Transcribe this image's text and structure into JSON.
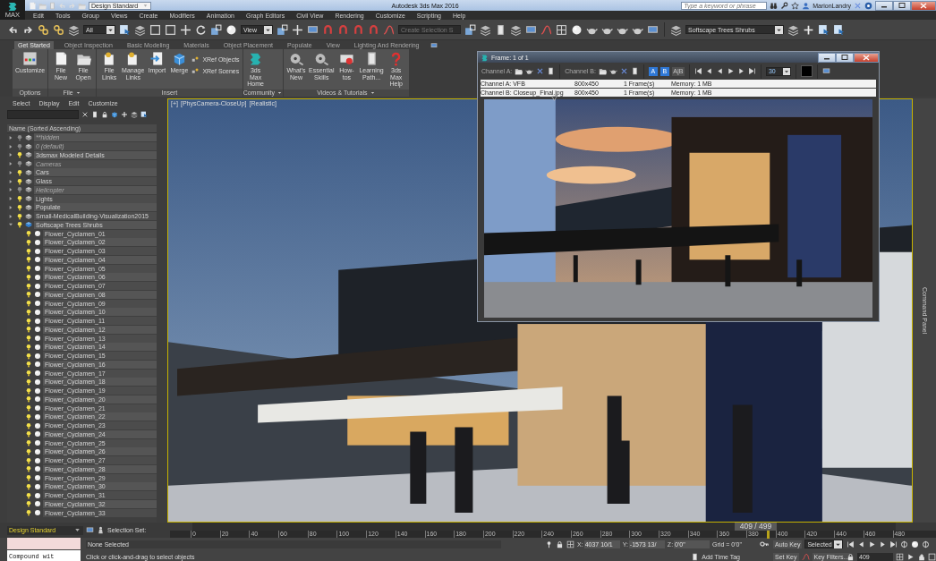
{
  "title_bar": {
    "app_badge": "MAX",
    "workspace": "Design Standard",
    "title": "Autodesk 3ds Max 2016",
    "search": {
      "placeholder": "Type a keyword or phrase"
    },
    "user": "MarionLandry"
  },
  "menu": [
    "Edit",
    "Tools",
    "Group",
    "Views",
    "Create",
    "Modifiers",
    "Animation",
    "Graph Editors",
    "Civil View",
    "Rendering",
    "Customize",
    "Scripting",
    "Help"
  ],
  "toolbar": {
    "selection_filter": "All",
    "reference_coord": "View",
    "selection_set": {
      "placeholder": "Create Selection S"
    },
    "layer": "Softscape Trees Shrubs"
  },
  "ribbon": {
    "tabs": [
      {
        "label": "Get Started",
        "selected": true
      },
      {
        "label": "Object Inspection",
        "selected": false
      },
      {
        "label": "Basic Modeling",
        "selected": false
      },
      {
        "label": "Materials",
        "selected": false
      },
      {
        "label": "Object Placement",
        "selected": false
      },
      {
        "label": "Populate",
        "selected": false
      },
      {
        "label": "View",
        "selected": false
      },
      {
        "label": "Lighting And Rendering",
        "selected": false
      }
    ],
    "groups": [
      {
        "label": "Options",
        "menu": false,
        "buttons": [
          {
            "label": "Customize",
            "kind": "large"
          }
        ]
      },
      {
        "label": "File",
        "menu": true,
        "buttons": [
          {
            "label": "File New",
            "kind": "large"
          },
          {
            "label": "File Open",
            "kind": "large"
          }
        ]
      },
      {
        "label": "Insert",
        "menu": false,
        "buttons": [
          {
            "label": "File Links",
            "kind": "large"
          },
          {
            "label": "Manage Links",
            "kind": "large"
          },
          {
            "label": "Import",
            "kind": "large"
          },
          {
            "label": "Merge",
            "kind": "large"
          },
          {
            "label": "XRef Objects",
            "kind": "small"
          },
          {
            "label": "XRef Scenes",
            "kind": "small"
          }
        ]
      },
      {
        "label": "Community",
        "menu": true,
        "buttons": [
          {
            "label": "3ds Max Home",
            "kind": "large"
          }
        ]
      },
      {
        "label": "Videos & Tutorials",
        "menu": true,
        "buttons": [
          {
            "label": "What's New",
            "kind": "large"
          },
          {
            "label": "Essential Skills",
            "kind": "large"
          },
          {
            "label": "How-tos",
            "kind": "large"
          },
          {
            "label": "Learning Path...",
            "kind": "large"
          },
          {
            "label": "3ds Max Help",
            "kind": "large"
          }
        ]
      }
    ]
  },
  "scene_explorer": {
    "menu": [
      "Select",
      "Display",
      "Edit",
      "Customize"
    ],
    "column": "Name (Sorted Ascending)",
    "tree": [
      {
        "name": "**hidden",
        "hidden": true,
        "active": false,
        "expanded": false
      },
      {
        "name": "0 (default)",
        "hidden": true,
        "active": false,
        "expanded": false
      },
      {
        "name": "3dsmax Modeled Details",
        "hidden": false,
        "active": false,
        "expanded": false
      },
      {
        "name": "Cameras",
        "hidden": true,
        "active": false,
        "expanded": false
      },
      {
        "name": "Cars",
        "hidden": false,
        "active": false,
        "expanded": false
      },
      {
        "name": "Glass",
        "hidden": false,
        "active": false,
        "expanded": false
      },
      {
        "name": "Helicopter",
        "hidden": true,
        "active": false,
        "expanded": false
      },
      {
        "name": "Lights",
        "hidden": false,
        "active": false,
        "expanded": false
      },
      {
        "name": "Populate",
        "hidden": false,
        "active": false,
        "expanded": false
      },
      {
        "name": "Small-MedicalBuilding-Visualization2015",
        "hidden": false,
        "active": false,
        "expanded": false
      },
      {
        "name": "Softscape Trees Shrubs",
        "hidden": false,
        "active": true,
        "expanded": true,
        "children": [
          {
            "name": "Flower_Cyclamen_01",
            "hidden": false
          },
          {
            "name": "Flower_Cyclamen_02",
            "hidden": false
          },
          {
            "name": "Flower_Cyclamen_03",
            "hidden": false
          },
          {
            "name": "Flower_Cyclamen_04",
            "hidden": false
          },
          {
            "name": "Flower_Cyclamen_05",
            "hidden": false
          },
          {
            "name": "Flower_Cyclamen_06",
            "hidden": false
          },
          {
            "name": "Flower_Cyclamen_07",
            "hidden": false
          },
          {
            "name": "Flower_Cyclamen_08",
            "hidden": false
          },
          {
            "name": "Flower_Cyclamen_09",
            "hidden": false
          },
          {
            "name": "Flower_Cyclamen_10",
            "hidden": false
          },
          {
            "name": "Flower_Cyclamen_11",
            "hidden": false
          },
          {
            "name": "Flower_Cyclamen_12",
            "hidden": false
          },
          {
            "name": "Flower_Cyclamen_13",
            "hidden": false
          },
          {
            "name": "Flower_Cyclamen_14",
            "hidden": false
          },
          {
            "name": "Flower_Cyclamen_15",
            "hidden": false
          },
          {
            "name": "Flower_Cyclamen_16",
            "hidden": false
          },
          {
            "name": "Flower_Cyclamen_17",
            "hidden": false
          },
          {
            "name": "Flower_Cyclamen_18",
            "hidden": false
          },
          {
            "name": "Flower_Cyclamen_19",
            "hidden": false
          },
          {
            "name": "Flower_Cyclamen_20",
            "hidden": false
          },
          {
            "name": "Flower_Cyclamen_21",
            "hidden": false
          },
          {
            "name": "Flower_Cyclamen_22",
            "hidden": false
          },
          {
            "name": "Flower_Cyclamen_23",
            "hidden": false
          },
          {
            "name": "Flower_Cyclamen_24",
            "hidden": false
          },
          {
            "name": "Flower_Cyclamen_25",
            "hidden": false
          },
          {
            "name": "Flower_Cyclamen_26",
            "hidden": false
          },
          {
            "name": "Flower_Cyclamen_27",
            "hidden": false
          },
          {
            "name": "Flower_Cyclamen_28",
            "hidden": false
          },
          {
            "name": "Flower_Cyclamen_29",
            "hidden": false
          },
          {
            "name": "Flower_Cyclamen_30",
            "hidden": false
          },
          {
            "name": "Flower_Cyclamen_31",
            "hidden": false
          },
          {
            "name": "Flower_Cyclamen_32",
            "hidden": false
          },
          {
            "name": "Flower_Cyclamen_33",
            "hidden": false
          }
        ]
      }
    ]
  },
  "viewport": {
    "labels": [
      "[+]",
      "[PhysCamera-CloseUp]",
      "[Realistic]"
    ],
    "picture": {
      "kind": "picture"
    }
  },
  "command_panel": {
    "label": "Command Panel"
  },
  "frame_window": {
    "title": "Frame: 1 of 1",
    "channel_a_label": "Channel A:",
    "channel_b_label": "Channel B:",
    "compare": [
      {
        "label": "A",
        "selected": true
      },
      {
        "label": "B",
        "selected": true
      },
      {
        "label": "A|B",
        "selected": false
      }
    ],
    "frame_rate": "30",
    "channels": [
      {
        "name": "Channel A: VFB",
        "size": "800x450",
        "frames": "1 Frame(s)",
        "memory": "Memory: 1 MB"
      },
      {
        "name": "Channel B: Closeup_Final.jpg",
        "size": "800x450",
        "frames": "1 Frame(s)",
        "memory": "Memory: 1 MB"
      }
    ],
    "picture": {
      "kind": "picture"
    }
  },
  "bottom": {
    "workspace": "Design Standard",
    "selection_set_label": "Selection Set:",
    "time_slider": {
      "reading": "409 / 499",
      "level": 0.82
    },
    "ruler": [
      "0",
      "20",
      "40",
      "60",
      "80",
      "100",
      "120",
      "140",
      "160",
      "180",
      "200",
      "220",
      "240",
      "260",
      "280",
      "300",
      "320",
      "340",
      "360",
      "380",
      "400",
      "420",
      "440",
      "460",
      "480"
    ],
    "maxscript": {
      "value": "Compound wit"
    },
    "selection_status": "None Selected",
    "prompt": "Click or click-and-drag to select objects",
    "coords": [
      {
        "label": "X:",
        "value": "4037 10/1"
      },
      {
        "label": "Y:",
        "value": "-1573 13/"
      },
      {
        "label": "Z:",
        "value": "0'0\""
      }
    ],
    "grid": "Grid = 0'0\"",
    "add_time_tag": "Add Time Tag",
    "auto_key": "Auto Key",
    "key_mode": "Selected",
    "set_key": "Set Key",
    "key_filters": "Key Filters...",
    "current_frame": "409"
  }
}
